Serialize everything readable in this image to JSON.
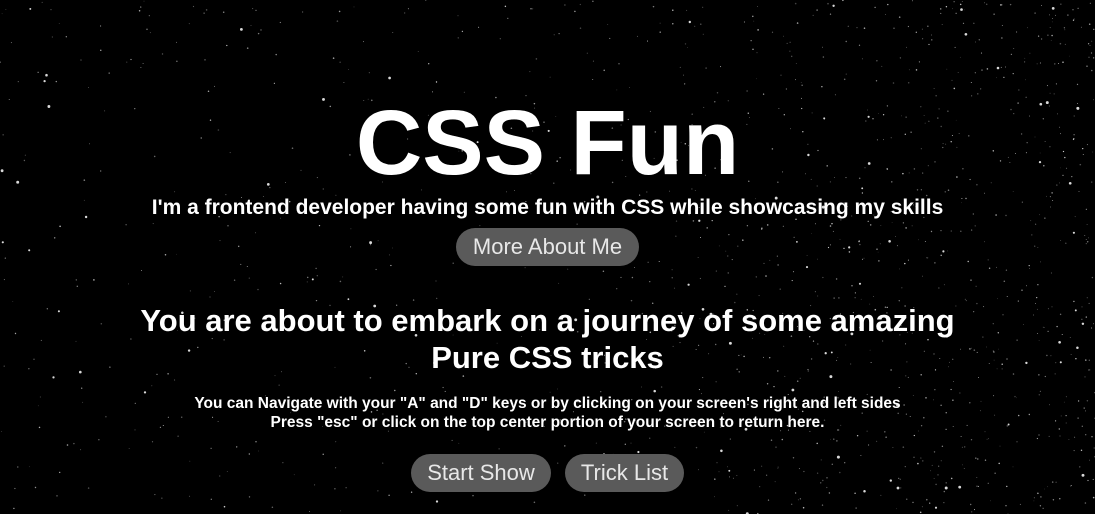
{
  "hero": {
    "title": "CSS Fun",
    "subtitle": "I'm a frontend developer having some fun with CSS while showcasing my skills",
    "about_label": "More About Me"
  },
  "intro": {
    "heading_line1": "You are about to embark on a journey of some amazing",
    "heading_line2": "Pure CSS tricks",
    "instruction_line1": "You can Navigate with your \"A\" and \"D\" keys or by clicking on your screen's right and left sides",
    "instruction_line2": "Press \"esc\" or click on the top center portion of your screen to return here."
  },
  "actions": {
    "start_label": "Start Show",
    "tricks_label": "Trick List"
  },
  "colors": {
    "background": "#000000",
    "text": "#ffffff",
    "button_bg": "#5a5a5a",
    "button_text": "#e8e8e8"
  }
}
